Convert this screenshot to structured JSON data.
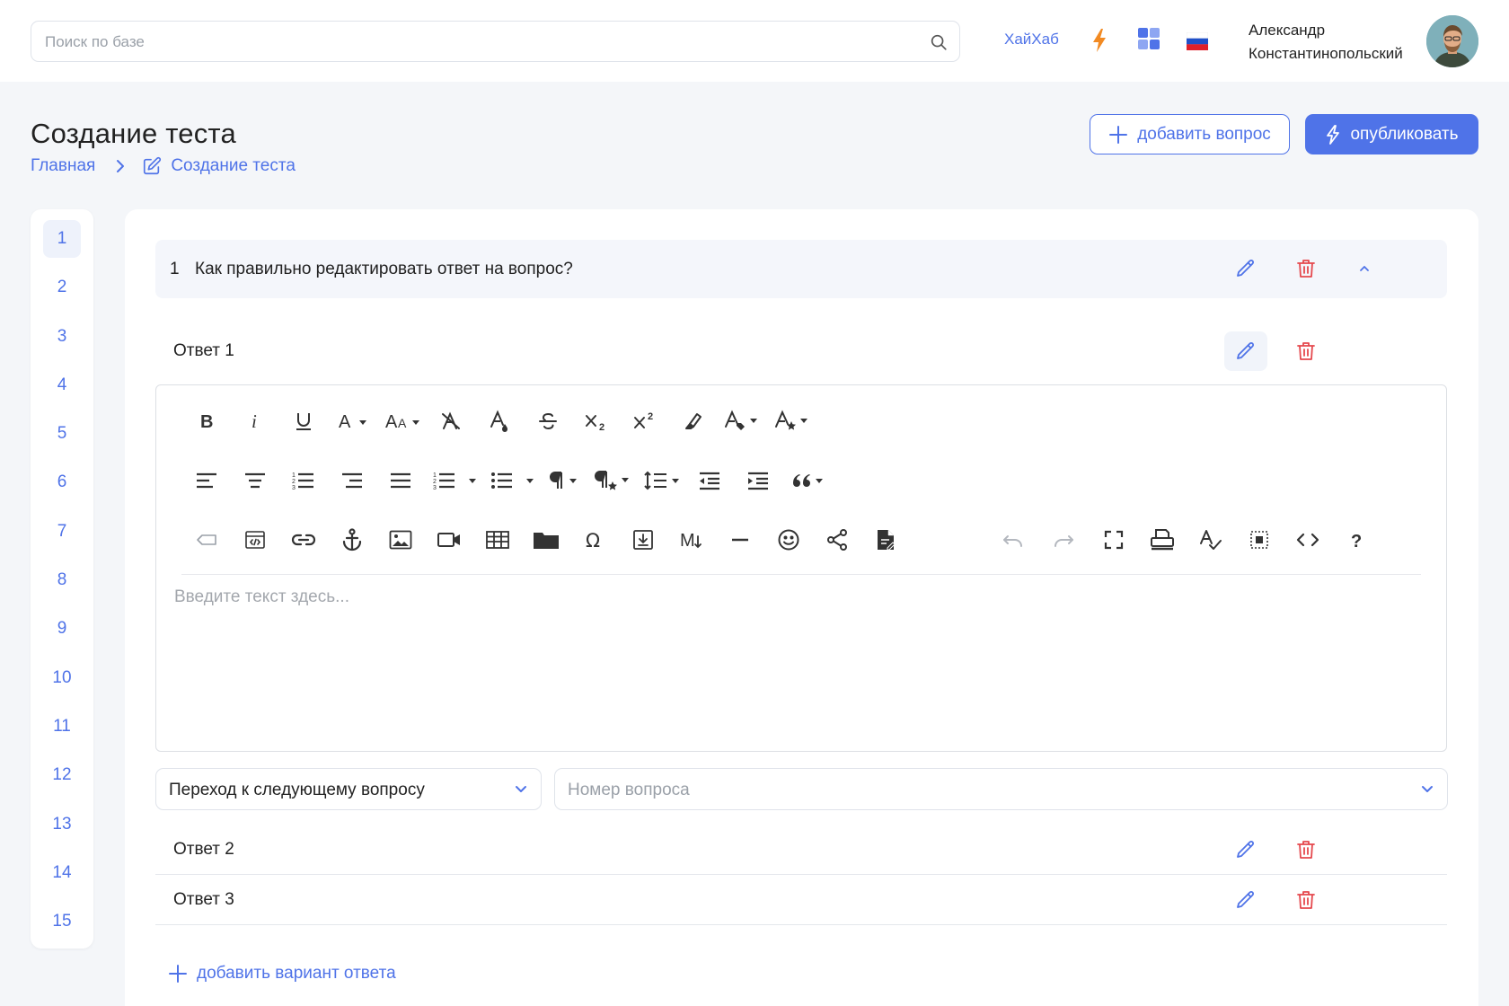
{
  "header": {
    "search_placeholder": "Поиск по базе",
    "brand_link": "ХайХаб",
    "user_first_name": "Александр",
    "user_last_name": "Константинопольский"
  },
  "page": {
    "title": "Создание теста",
    "breadcrumb": {
      "home": "Главная",
      "current": "Создание теста"
    },
    "add_question_label": "добавить вопрос",
    "publish_label": "опубликовать"
  },
  "question_nav": [
    "1",
    "2",
    "3",
    "4",
    "5",
    "6",
    "7",
    "8",
    "9",
    "10",
    "11",
    "12",
    "13",
    "14",
    "15"
  ],
  "question": {
    "number": "1",
    "text": "Как правильно редактировать ответ на вопрос?"
  },
  "answers": [
    {
      "label": "Ответ 1"
    },
    {
      "label": "Ответ 2"
    },
    {
      "label": "Ответ 3"
    }
  ],
  "editor": {
    "placeholder": "Введите текст здесь...",
    "toolbar_icons": [
      "bold-icon",
      "italic-icon",
      "underline-icon",
      "font-family-icon",
      "font-size-icon",
      "clear-formatting-icon",
      "text-color-icon",
      "strikethrough-icon",
      "subscript-icon",
      "superscript-icon",
      "highlight-icon",
      "inline-class-icon",
      "inline-style-icon",
      "align-left-icon",
      "align-center-icon",
      "ordered-list-icon",
      "align-right-icon",
      "justify-icon",
      "ordered-list-dropdown-icon",
      "unordered-list-icon",
      "paragraph-format-icon",
      "paragraph-style-icon",
      "line-height-icon",
      "outdent-icon",
      "indent-icon",
      "quote-icon",
      "tag-icon",
      "embed-icon",
      "link-icon",
      "anchor-icon",
      "image-icon",
      "video-icon",
      "table-icon",
      "folder-icon",
      "special-char-icon",
      "import-icon",
      "markdown-icon",
      "horizontal-line-icon",
      "emoticon-icon",
      "share-icon",
      "document-icon",
      "undo-icon",
      "redo-icon",
      "fullscreen-icon",
      "print-icon",
      "spellcheck-icon",
      "select-all-icon",
      "code-view-icon",
      "help-icon"
    ],
    "markdown_glyph": "M"
  },
  "transition": {
    "selected": "Переход к следующему вопросу",
    "number_placeholder": "Номер вопроса"
  },
  "add_answer_label": "добавить вариант ответа",
  "colors": {
    "accent": "#4f73e8",
    "danger": "#e5484d",
    "lightning": "#f28a22"
  }
}
